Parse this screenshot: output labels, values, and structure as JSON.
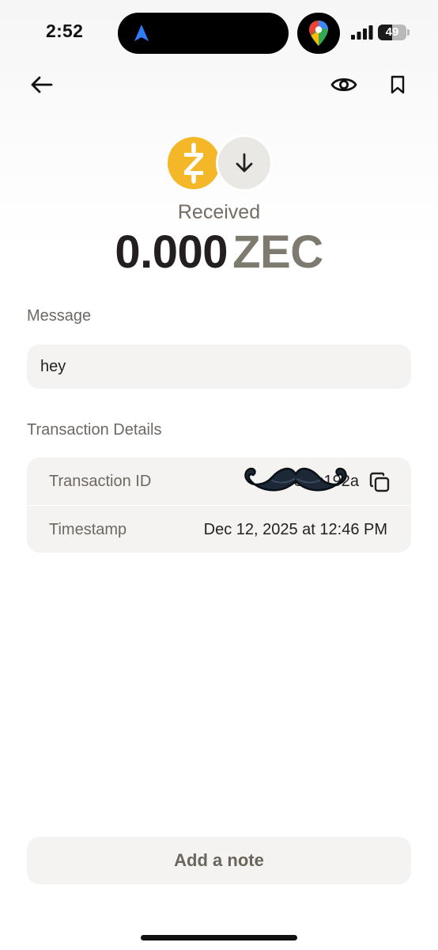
{
  "status_bar": {
    "time": "2:52",
    "battery_level": "49",
    "battery_fraction": 0.49
  },
  "nav": {
    "back_icon": "arrow-left-icon",
    "eye_icon": "eye-icon",
    "bookmark_icon": "bookmark-icon"
  },
  "transaction": {
    "coin_icon": "zcash-icon",
    "direction_icon": "arrow-down-icon",
    "type_label": "Received",
    "amount": "0.000",
    "unit": "ZEC"
  },
  "message": {
    "label": "Message",
    "text": "hey"
  },
  "details": {
    "heading": "Transaction Details",
    "rows": [
      {
        "label": "Transaction ID",
        "value": "8...c192a"
      },
      {
        "label": "Timestamp",
        "value": "Dec 12, 2025 at 12:46 PM"
      }
    ]
  },
  "actions": {
    "add_note_label": "Add a note"
  },
  "colors": {
    "zec_yellow": "#f4b728",
    "text_primary": "#231f20",
    "text_muted": "#6d6861",
    "card_bg": "#f4f3f1"
  }
}
